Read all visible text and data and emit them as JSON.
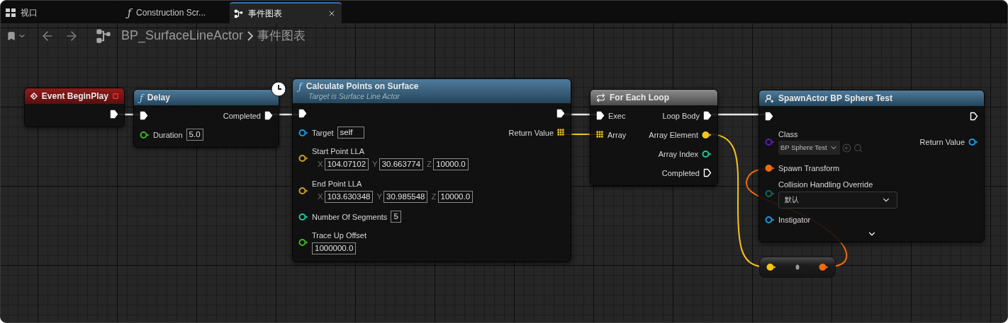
{
  "tabs": [
    {
      "kind": "viewport",
      "label": "视口",
      "selected": false,
      "closable": false
    },
    {
      "kind": "function",
      "glyph": "ƒ",
      "label": "Construction Scr...",
      "selected": false,
      "closable": false
    },
    {
      "kind": "graph",
      "label": "事件图表",
      "selected": true,
      "closable": true
    }
  ],
  "breadcrumb": {
    "asset": "BP_SurfaceLineActor",
    "graph": "事件图表"
  },
  "nodes": [
    {
      "kind": "event",
      "title": "Event BeginPlay",
      "delegate": true,
      "rows": [
        {
          "right": {
            "kind": "exec",
            "connected": true
          }
        }
      ]
    },
    {
      "kind": "function",
      "glyph": "ƒ",
      "title": "Delay",
      "latent": true,
      "rows": [
        {
          "left": {
            "kind": "exec",
            "connected": true
          },
          "right": {
            "kind": "exec",
            "label": "Completed",
            "connected": true
          }
        },
        {
          "left": {
            "kind": "data",
            "label": "Duration",
            "color": "#3cb81e",
            "connected": false,
            "value": "5.0"
          }
        }
      ]
    },
    {
      "kind": "function",
      "glyph": "ƒ",
      "title": "Calculate Points on Surface",
      "subtitle": "Target is Surface Line Actor",
      "rows": [
        {
          "left": {
            "kind": "exec",
            "connected": true
          },
          "right": {
            "kind": "exec",
            "connected": true
          }
        },
        {
          "left": {
            "kind": "data",
            "label": "Target",
            "color": "#1a9be0",
            "connected": false,
            "value": "self"
          },
          "right": {
            "kind": "array",
            "label": "Return Value",
            "color": "#f5c518",
            "connected": true
          }
        },
        {
          "left": {
            "kind": "vector",
            "label": "Start Point LLA",
            "color": "#c9a227",
            "connected": false,
            "fields": [
              {
                "axis": "X",
                "value": "104.07102"
              },
              {
                "axis": "Y",
                "value": "30.663774"
              },
              {
                "axis": "Z",
                "value": "10000.0"
              }
            ]
          }
        },
        {
          "left": {
            "kind": "vector",
            "label": "End Point LLA",
            "color": "#c9a227",
            "connected": false,
            "fields": [
              {
                "axis": "X",
                "value": "103.630348"
              },
              {
                "axis": "Y",
                "value": "30.985548"
              },
              {
                "axis": "Z",
                "value": "10000.0"
              }
            ]
          }
        },
        {
          "left": {
            "kind": "data",
            "label": "Number Of Segments",
            "color": "#1ec8a0",
            "connected": false,
            "value": "5"
          }
        },
        {
          "left": {
            "kind": "data_below",
            "label": "Trace Up Offset",
            "color": "#3cb81e",
            "connected": false,
            "value": "1000000.0"
          }
        }
      ]
    },
    {
      "kind": "macro",
      "title": "For Each Loop",
      "rows": [
        {
          "left": {
            "kind": "exec",
            "label": "Exec",
            "connected": true
          },
          "right": {
            "kind": "exec",
            "label": "Loop Body",
            "connected": true
          }
        },
        {
          "left": {
            "kind": "array",
            "label": "Array",
            "color": "#f5c518",
            "connected": true
          },
          "right": {
            "kind": "data",
            "label": "Array Element",
            "color": "#f5c518",
            "connected": true
          }
        },
        {
          "right": {
            "kind": "data",
            "label": "Array Index",
            "color": "#1ec8a0",
            "connected": false
          }
        },
        {
          "right": {
            "kind": "exec",
            "label": "Completed",
            "connected": false
          }
        }
      ]
    },
    {
      "kind": "spawn",
      "title": "SpawnActor BP Sphere Test",
      "expandable": true,
      "rows": [
        {
          "left": {
            "kind": "exec",
            "connected": true
          },
          "right": {
            "kind": "exec",
            "connected": false
          }
        },
        {
          "left": {
            "kind": "class",
            "label": "Class",
            "color": "#5b1fb5",
            "connected": false,
            "value": "BP Sphere Test"
          },
          "right": {
            "kind": "data",
            "label": "Return Value",
            "color": "#1a9be0",
            "connected": false
          }
        },
        {
          "left": {
            "kind": "data",
            "label": "Spawn Transform",
            "color": "#f06a10",
            "connected": true
          }
        },
        {
          "left": {
            "kind": "enum",
            "label": "Collision Handling Override",
            "color": "#0a6b5e",
            "connected": false,
            "value": "默认"
          }
        },
        {
          "left": {
            "kind": "data",
            "label": "Instigator",
            "color": "#1a9be0",
            "connected": false
          }
        }
      ]
    },
    {
      "kind": "reroute",
      "rows": [
        {
          "left": {
            "kind": "data",
            "color": "#f5c518",
            "connected": true
          },
          "right": {
            "kind": "data",
            "color": "#f06a10",
            "connected": true
          }
        }
      ]
    }
  ]
}
